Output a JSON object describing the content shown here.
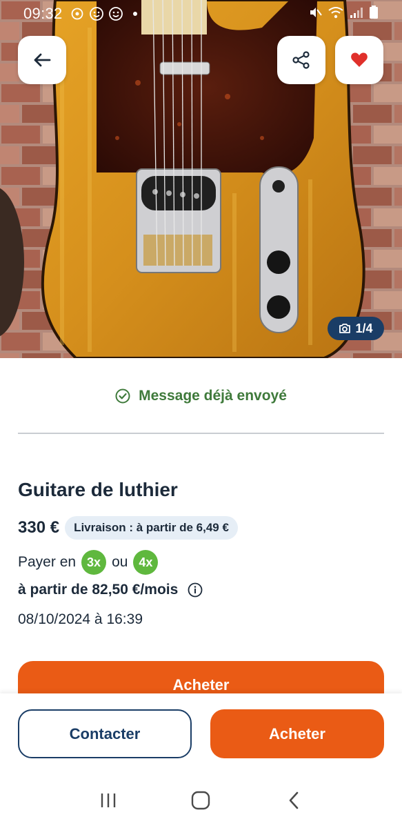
{
  "status_bar": {
    "time": "09:32",
    "left_icons": [
      "media-icon",
      "smiley-icon",
      "smiley-icon"
    ],
    "right_icons": [
      "mute-icon",
      "wifi-icon",
      "signal-icon",
      "battery-icon"
    ]
  },
  "gallery": {
    "counter": "1/4",
    "icons": {
      "back": "arrow-left-icon",
      "share": "share-icon",
      "favorite": "heart-icon"
    },
    "favorite_color": "#e0302b"
  },
  "message_status": {
    "text": "Message déjà envoyé",
    "color": "#3f7a3b"
  },
  "listing": {
    "title": "Guitare de luthier",
    "price": "330 €",
    "delivery": "Livraison : à partir de 6,49 €",
    "pay_prefix": "Payer en",
    "pay_option_1": "3x",
    "pay_or": "ou",
    "pay_option_2": "4x",
    "monthly": "à partir de 82,50 €/mois",
    "date": "08/10/2024 à 16:39"
  },
  "buttons": {
    "buy_inline": "Acheter",
    "contact": "Contacter",
    "buy": "Acheter"
  },
  "colors": {
    "accent_orange": "#ea5b15",
    "navy": "#1a3d66",
    "installment_green": "#5fb83e"
  },
  "nav": [
    "recent-apps-icon",
    "home-icon",
    "back-icon"
  ]
}
